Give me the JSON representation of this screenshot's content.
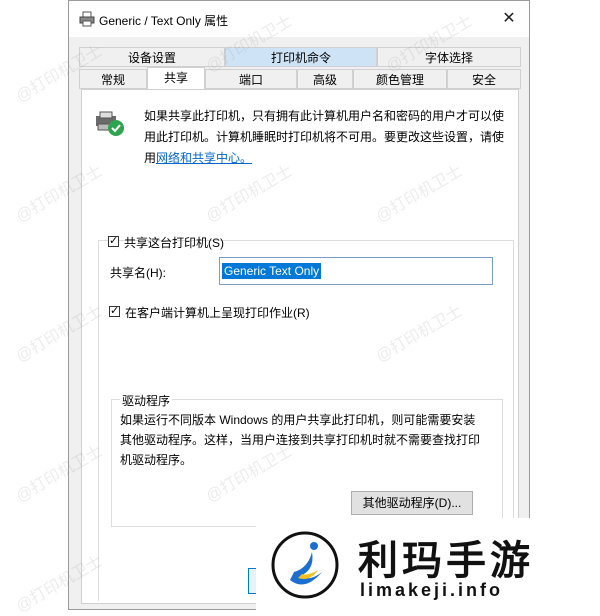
{
  "window": {
    "title": "Generic / Text Only 属性"
  },
  "tabs_row1": [
    "设备设置",
    "打印机命令",
    "字体选择"
  ],
  "tabs_row2": [
    "常规",
    "共享",
    "端口",
    "高级",
    "颜色管理",
    "安全"
  ],
  "info": {
    "text": "如果共享此打印机，只有拥有此计算机用户名和密码的用户才可以使用此打印机。计算机睡眠时打印机将不可用。要更改这些设置，请使用",
    "link": "网络和共享中心。"
  },
  "share": {
    "share_checkbox_label": "共享这台打印机(S)",
    "share_name_label": "共享名(H):",
    "share_name_value": "Generic  Text Only",
    "render_checkbox_label": "在客户端计算机上呈现打印作业(R)"
  },
  "drivers": {
    "legend": "驱动程序",
    "text": "如果运行不同版本 Windows 的用户共享此打印机，则可能需要安装其他驱动程序。这样，当用户连接到共享打印机时就不需要查找打印机驱动程序。",
    "button": "其他驱动程序(D)..."
  },
  "brand": {
    "name": "利玛手游",
    "url": "limakeji.info"
  },
  "watermark_text": "@打印机卫士",
  "colors": {
    "accent": "#0078d7",
    "link": "#0066cc"
  },
  "icons": {
    "title": "printer-icon",
    "info": "shared-printer-icon",
    "close": "close-icon"
  }
}
